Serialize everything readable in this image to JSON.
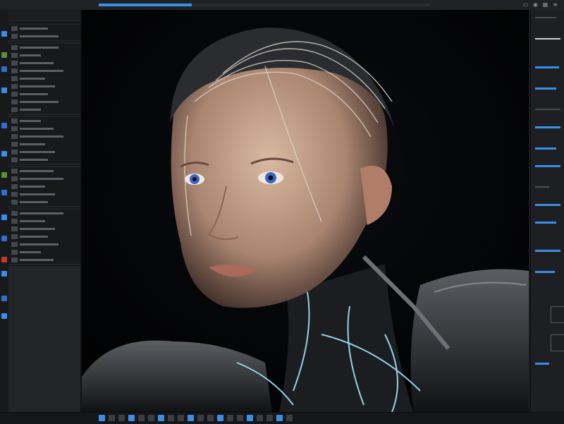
{
  "window": {
    "title": "",
    "progress_percent": 28
  },
  "top_icons": [
    "dock-icon",
    "eye-icon",
    "grid-icon",
    "menu-icon"
  ],
  "left_panel": {
    "header": "",
    "sections": [
      {
        "rows": [
          "",
          ""
        ]
      },
      {
        "rows": [
          "",
          "",
          "",
          "",
          "",
          "",
          "",
          "",
          ""
        ]
      },
      {
        "rows": [
          "",
          "",
          "",
          "",
          "",
          ""
        ]
      },
      {
        "rows": [
          "",
          "",
          "",
          "",
          ""
        ]
      },
      {
        "rows": [
          "",
          "",
          "",
          "",
          "",
          "",
          ""
        ]
      }
    ]
  },
  "canvas": {
    "subject": "cyborg-portrait"
  },
  "colors": {
    "accent": "#3a8ee6",
    "panel": "#232427",
    "canvas_bg": "#030405",
    "skin": "#c9a890",
    "eye": "#3b66c9",
    "glow": "#9fe6ff"
  },
  "bottom_icons": [
    "layer-icon",
    "move-icon",
    "brush-icon",
    "eraser-icon",
    "blur-icon",
    "dodge-icon",
    "pen-icon",
    "text-icon",
    "shape-icon",
    "hand-icon",
    "zoom-icon",
    "crop-icon",
    "mask-icon",
    "fill-icon",
    "eyedropper-icon",
    "grid-icon",
    "rotate-icon",
    "flip-icon",
    "lock-icon",
    "link-icon"
  ]
}
